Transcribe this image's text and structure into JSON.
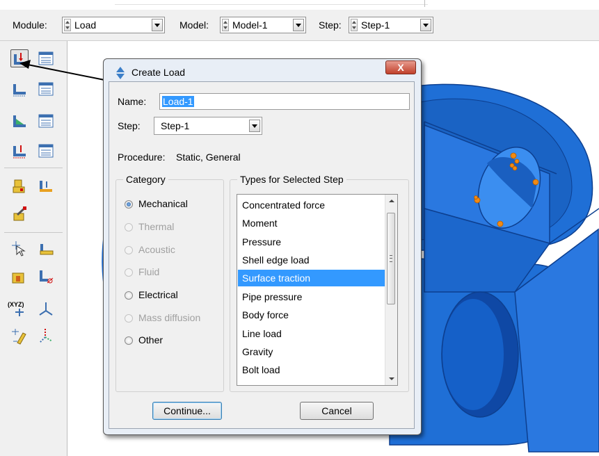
{
  "toolbar": {
    "module_label": "Module:",
    "module_value": "Load",
    "model_label": "Model:",
    "model_value": "Model-1",
    "step_label": "Step:",
    "step_value": "Step-1"
  },
  "toolbox": {
    "items": [
      {
        "name": "create-load-tool",
        "pressed": true
      },
      {
        "name": "load-manager-tool"
      },
      {
        "name": "create-bc-tool"
      },
      {
        "name": "bc-manager-tool"
      },
      {
        "name": "create-predefined-field-tool"
      },
      {
        "name": "predefined-field-manager-tool"
      },
      {
        "name": "create-load-case-tool"
      },
      {
        "name": "load-case-manager-tool"
      },
      {
        "name": "create-field-tool"
      },
      {
        "name": "create-amplitude-tool"
      },
      {
        "name": "create-analytical-field-tool"
      },
      {
        "name": "create-set-tool"
      },
      {
        "name": "create-surface-tool"
      },
      {
        "name": "create-datum-tool"
      },
      {
        "name": "create-coordinate-system-tool"
      },
      {
        "name": "datum-csys-tool"
      },
      {
        "name": "query-tool"
      },
      {
        "name": "axis-tool"
      }
    ],
    "xyz_label": "(XYZ)"
  },
  "dialog": {
    "title": "Create Load",
    "close_label": "X",
    "name_label": "Name:",
    "name_value": "Load-1",
    "step_label": "Step:",
    "step_value": "Step-1",
    "procedure_label": "Procedure:",
    "procedure_value": "Static, General",
    "category_title": "Category",
    "categories": [
      {
        "label": "Mechanical",
        "selected": true,
        "enabled": true
      },
      {
        "label": "Thermal",
        "selected": false,
        "enabled": false
      },
      {
        "label": "Acoustic",
        "selected": false,
        "enabled": false
      },
      {
        "label": "Fluid",
        "selected": false,
        "enabled": false
      },
      {
        "label": "Electrical",
        "selected": false,
        "enabled": true
      },
      {
        "label": "Mass diffusion",
        "selected": false,
        "enabled": false
      },
      {
        "label": "Other",
        "selected": false,
        "enabled": true
      }
    ],
    "types_title": "Types for Selected Step",
    "types": [
      "Concentrated force",
      "Moment",
      "Pressure",
      "Shell edge load",
      "Surface traction",
      "Pipe pressure",
      "Body force",
      "Line load",
      "Gravity",
      "Bolt load"
    ],
    "selected_type": "Surface traction",
    "continue_label": "Continue...",
    "cancel_label": "Cancel"
  },
  "colors": {
    "part_blue": "#1f6fd6",
    "part_dark": "#0d3f8f",
    "marker_orange": "#f08a14",
    "selection_blue": "#3399ff"
  }
}
